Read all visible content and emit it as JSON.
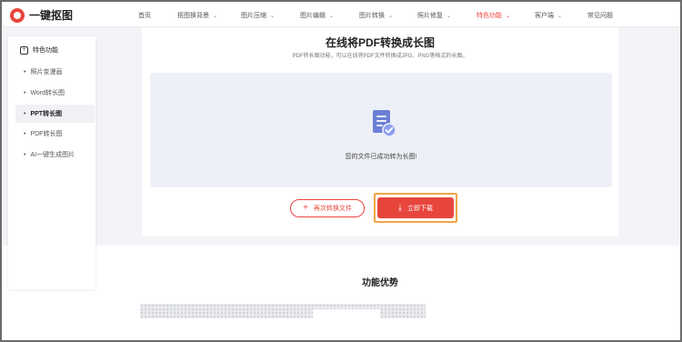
{
  "app": {
    "name": "一键抠图",
    "logo_color": "#e8453c"
  },
  "nav": {
    "items": [
      {
        "label": "首页",
        "has_dropdown": false,
        "active": false
      },
      {
        "label": "抠图换背景",
        "has_dropdown": true,
        "active": false
      },
      {
        "label": "图片压缩",
        "has_dropdown": true,
        "active": false
      },
      {
        "label": "图片编辑",
        "has_dropdown": true,
        "active": false
      },
      {
        "label": "图片转换",
        "has_dropdown": true,
        "active": false
      },
      {
        "label": "照片修复",
        "has_dropdown": true,
        "active": false
      },
      {
        "label": "特色功能",
        "has_dropdown": true,
        "active": true
      },
      {
        "label": "客户端",
        "has_dropdown": true,
        "active": false
      },
      {
        "label": "常见问题",
        "has_dropdown": false,
        "active": false
      }
    ],
    "active_color": "#e8453c"
  },
  "sidebar": {
    "title": "特色功能",
    "items": [
      {
        "label": "照片变漫画",
        "active": false
      },
      {
        "label": "Word转长图",
        "active": false
      },
      {
        "label": "PPT转长图",
        "active": true
      },
      {
        "label": "PDF转长图",
        "active": false
      },
      {
        "label": "AI一键生成图片",
        "active": false
      }
    ]
  },
  "main": {
    "title": "在线将PDF转换成长图",
    "subtitle": "PDF转长图功能，可以在线将PDF文件转换成JPG、PNG等格式的长图。",
    "file_icon": "document-check-icon",
    "success_text": "您的文件已成功转为长图!",
    "convert_again_label": "再次转换文件",
    "download_label": "立即下载",
    "accent_color": "#e8453c",
    "highlight_color": "#f2a444"
  },
  "advantages": {
    "title": "功能优势"
  }
}
